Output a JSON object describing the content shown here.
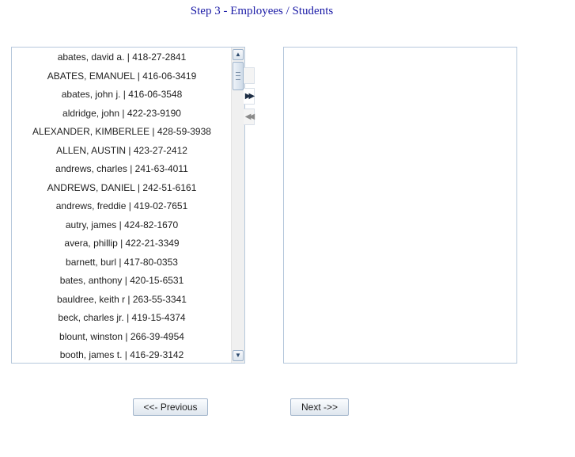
{
  "header": {
    "title": "Step 3 - Employees / Students"
  },
  "available_list": {
    "items": [
      "abates, david a. | 418-27-2841",
      "ABATES, EMANUEL | 416-06-3419",
      "abates, john j. | 416-06-3548",
      "aldridge, john | 422-23-9190",
      "ALEXANDER, KIMBERLEE | 428-59-3938",
      "ALLEN, AUSTIN | 423-27-2412",
      "andrews, charles | 241-63-4011",
      "ANDREWS, DANIEL | 242-51-6161",
      "andrews, freddie | 419-02-7651",
      "autry, james | 424-82-1670",
      "avera, phillip | 422-21-3349",
      "barnett, burl | 417-80-0353",
      "bates, anthony | 420-15-6531",
      "bauldree, keith r | 263-55-3341",
      "beck, charles jr. | 419-15-4374",
      "blount, winston | 266-39-4954",
      "booth, james t. | 416-29-3142"
    ]
  },
  "selected_list": {
    "items": []
  },
  "transfer_buttons": {
    "add_glyph": "▶▶",
    "remove_glyph": "◀◀"
  },
  "navigation": {
    "previous_label": "<<- Previous",
    "next_label": "Next ->>"
  }
}
